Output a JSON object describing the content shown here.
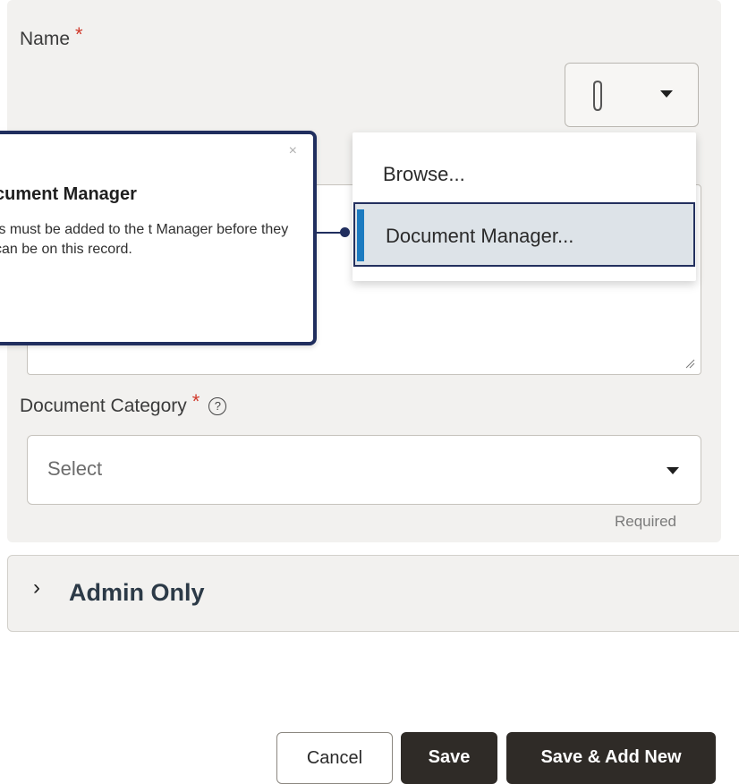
{
  "form": {
    "name_label": "Name",
    "required_mark": "*",
    "name_value": "",
    "document_category_label": "Document Category",
    "help_glyph": "?",
    "document_category_value": "Select",
    "required_note": "Required"
  },
  "attach_menu": {
    "items": [
      {
        "label": "Browse..."
      },
      {
        "label": "Document Manager..."
      }
    ],
    "highlighted_index": 1
  },
  "popover": {
    "close_glyph": "×",
    "title": "cument Manager",
    "body": "ts must be added to the t Manager before they can be on this record."
  },
  "admin_section": {
    "label": "Admin Only",
    "chevron": "›",
    "expanded": false
  },
  "footer": {
    "cancel_label": "Cancel",
    "save_label": "Save",
    "save_add_new_label": "Save & Add New"
  },
  "colors": {
    "panel_bg": "#f2f1ef",
    "popover_border": "#202e5e",
    "highlight_bg": "#dde3e8",
    "highlight_accent": "#1c7bc0",
    "primary_button_bg": "#2f2b27",
    "required_color": "#d0392b"
  },
  "icons": [
    "paperclip-icon",
    "caret-down-icon",
    "help-icon",
    "close-icon",
    "chevron-right-icon",
    "resize-grip-icon"
  ]
}
